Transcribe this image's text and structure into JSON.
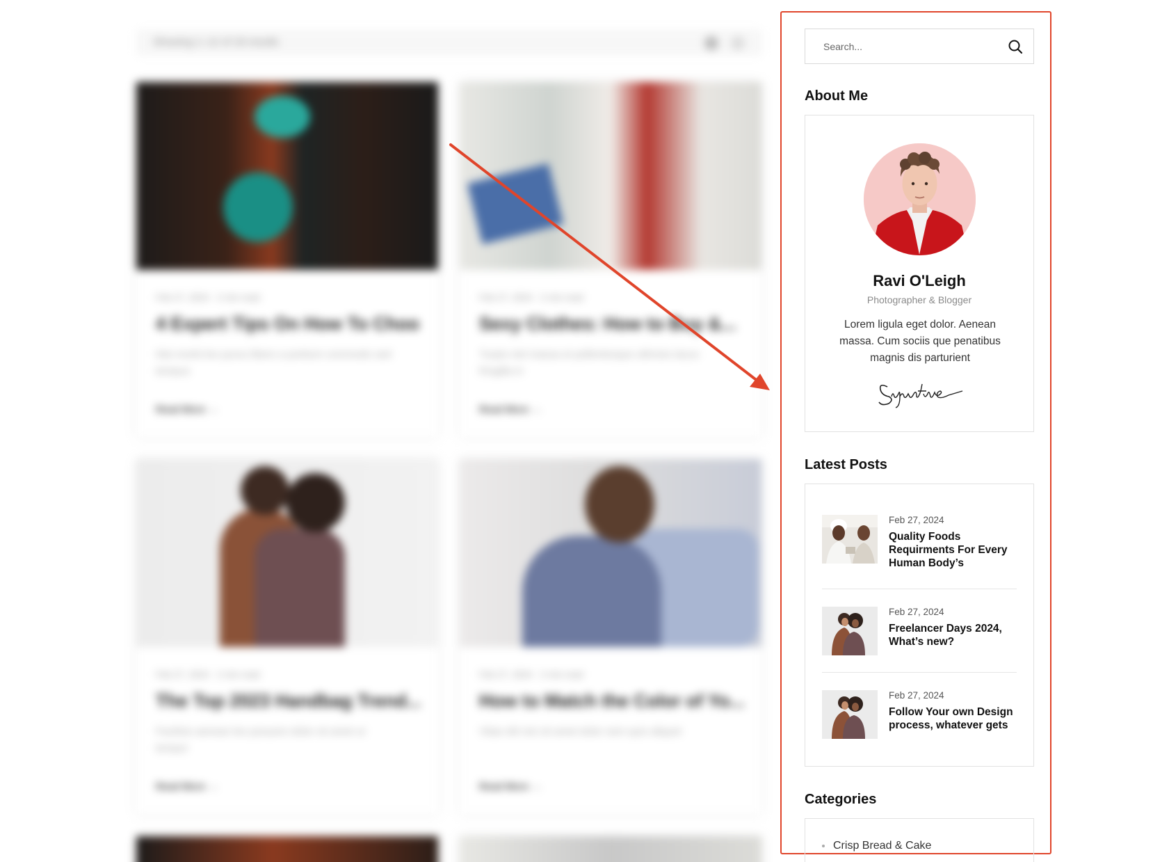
{
  "blog_grid": {
    "topbar_text": "Showing 1–12 of 18 results",
    "cards": [
      {
        "meta": "Feb 27, 2024   ·   2 min read",
        "title": "4 Expert Tips On How To Choo...",
        "excerpt": "Nisi morbi leo purus libero a pretium commodo sed tempus",
        "read_more": "Read More  →"
      },
      {
        "meta": "Feb 27, 2024   ·   2 min read",
        "title": "Sexy Clothes: How to Buy &...",
        "excerpt": "Turpis nisl massa et pellentesque ultricies lacus fringilla in",
        "read_more": "Read More  →"
      },
      {
        "meta": "Feb 27, 2024   ·   2 min read",
        "title": "The Top 2023 Handbag Trend...",
        "excerpt": "Facilisis aenean leo posuere dolor sit amet ut tempor",
        "read_more": "Read More  →"
      },
      {
        "meta": "Feb 27, 2024   ·   2 min read",
        "title": "How to Match the Color of Yo...",
        "excerpt": "Vitae elit nisi sit amet dolor sem quis aliquet",
        "read_more": "Read More  →"
      }
    ]
  },
  "colors": {
    "accent_red": "#e0452b",
    "border": "#e2e2e2",
    "text_dark": "#111111",
    "text_muted": "#8a8a8a"
  },
  "sidebar": {
    "search": {
      "placeholder": "Search...",
      "icon": "search-icon"
    },
    "about": {
      "title": "About Me",
      "name": "Ravi O'Leigh",
      "role": "Photographer & Blogger",
      "bio": "Lorem ligula eget dolor. Aenean massa. Cum sociis que penatibus magnis dis parturient",
      "signature": "Signature"
    },
    "latest_posts": {
      "title": "Latest Posts",
      "items": [
        {
          "date": "Feb 27, 2024",
          "title": "Quality Foods Requirments For Every Human Body’s"
        },
        {
          "date": "Feb 27, 2024",
          "title": "Freelancer Days 2024, What’s new?"
        },
        {
          "date": "Feb 27, 2024",
          "title": "Follow Your own Design process, whatever gets"
        }
      ]
    },
    "categories": {
      "title": "Categories",
      "items": [
        {
          "label": "Crisp Bread & Cake"
        }
      ]
    }
  }
}
